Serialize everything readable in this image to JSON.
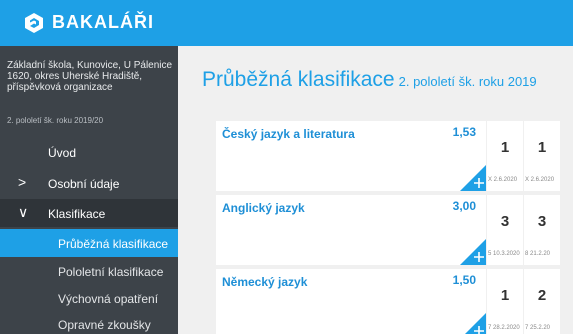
{
  "brand": {
    "name": "BAKALÁŘI",
    "accent": "#1ea0e6"
  },
  "sidebar": {
    "school": "Základní škola, Kunovice, U Pálenice 1620, okres Uherské Hradiště, příspěvková organizace",
    "term": "2. pololetí šk. roku 2019/20",
    "items": [
      {
        "label": "Úvod"
      },
      {
        "label": "Osobní údaje",
        "chevron": ">"
      },
      {
        "label": "Klasifikace",
        "chevron": "∨"
      },
      {
        "label": "Průběžná klasifikace"
      },
      {
        "label": "Pololetní klasifikace"
      },
      {
        "label": "Výchovná opatření"
      },
      {
        "label": "Opravné zkoušky"
      }
    ]
  },
  "main": {
    "title": "Průběžná klasifikace",
    "subtitle": "2. pololetí šk. roku 2019",
    "subjects": [
      {
        "name": "Český jazyk a literatura",
        "average": "1,53",
        "grades": [
          {
            "value": "1",
            "date": "X 2.6.2020"
          },
          {
            "value": "1",
            "date": "X 2.6.2020"
          }
        ]
      },
      {
        "name": "Anglický jazyk",
        "average": "3,00",
        "grades": [
          {
            "value": "3",
            "date": "5 10.3.2020"
          },
          {
            "value": "3",
            "date": "8 21.2.20"
          }
        ]
      },
      {
        "name": "Německý jazyk",
        "average": "1,50",
        "grades": [
          {
            "value": "1",
            "date": "7 28.2.2020"
          },
          {
            "value": "2",
            "date": "7 25.2.20"
          }
        ]
      }
    ]
  }
}
